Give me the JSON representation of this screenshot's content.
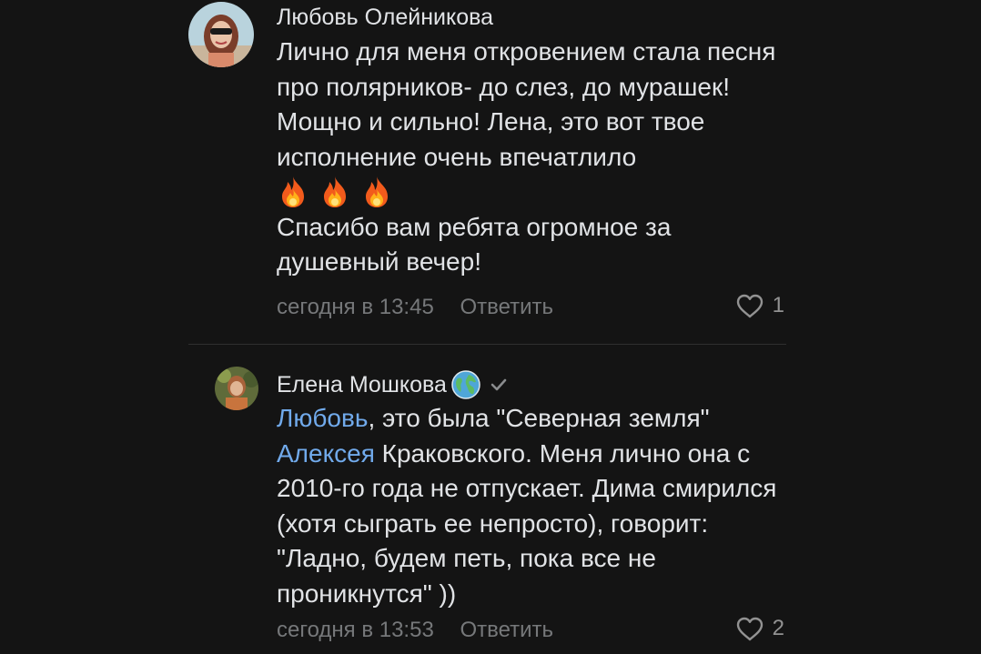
{
  "comments": [
    {
      "author": "Любовь Олейникова",
      "avatar_icon": "user-photo-avatar",
      "paragraph1": "Лично для меня откровением стала песня про полярников- до слез, до мурашек! Мощно и сильно! Лена, это вот твое исполнение очень впечатлило",
      "emojis": "🔥🔥🔥",
      "paragraph2": "Спасибо вам ребята огромное за душевный вечер!",
      "timestamp": "сегодня в 13:45",
      "reply_label": "Ответить",
      "likes": "1"
    },
    {
      "author": "Елена Мошкова",
      "avatar_icon": "user-photo-avatar",
      "badge_icon": "globe-icon",
      "verified_icon": "verified-check-icon",
      "mention1": "Любовь",
      "text1": ", это была \"Северная земля\"",
      "mention2": "Алексея",
      "text2": " Краковского. Меня лично она с 2010-го года не отпускает. Дима смирился (хотя сыграть ее непросто), говорит: \"Ладно, будем петь, пока все не проникнутся\" ))",
      "timestamp": "сегодня в 13:53",
      "reply_label": "Ответить",
      "likes": "2"
    }
  ],
  "colors": {
    "background": "#141414",
    "text": "#e1e3e6",
    "secondary": "#76787a",
    "link": "#71aaeb"
  }
}
